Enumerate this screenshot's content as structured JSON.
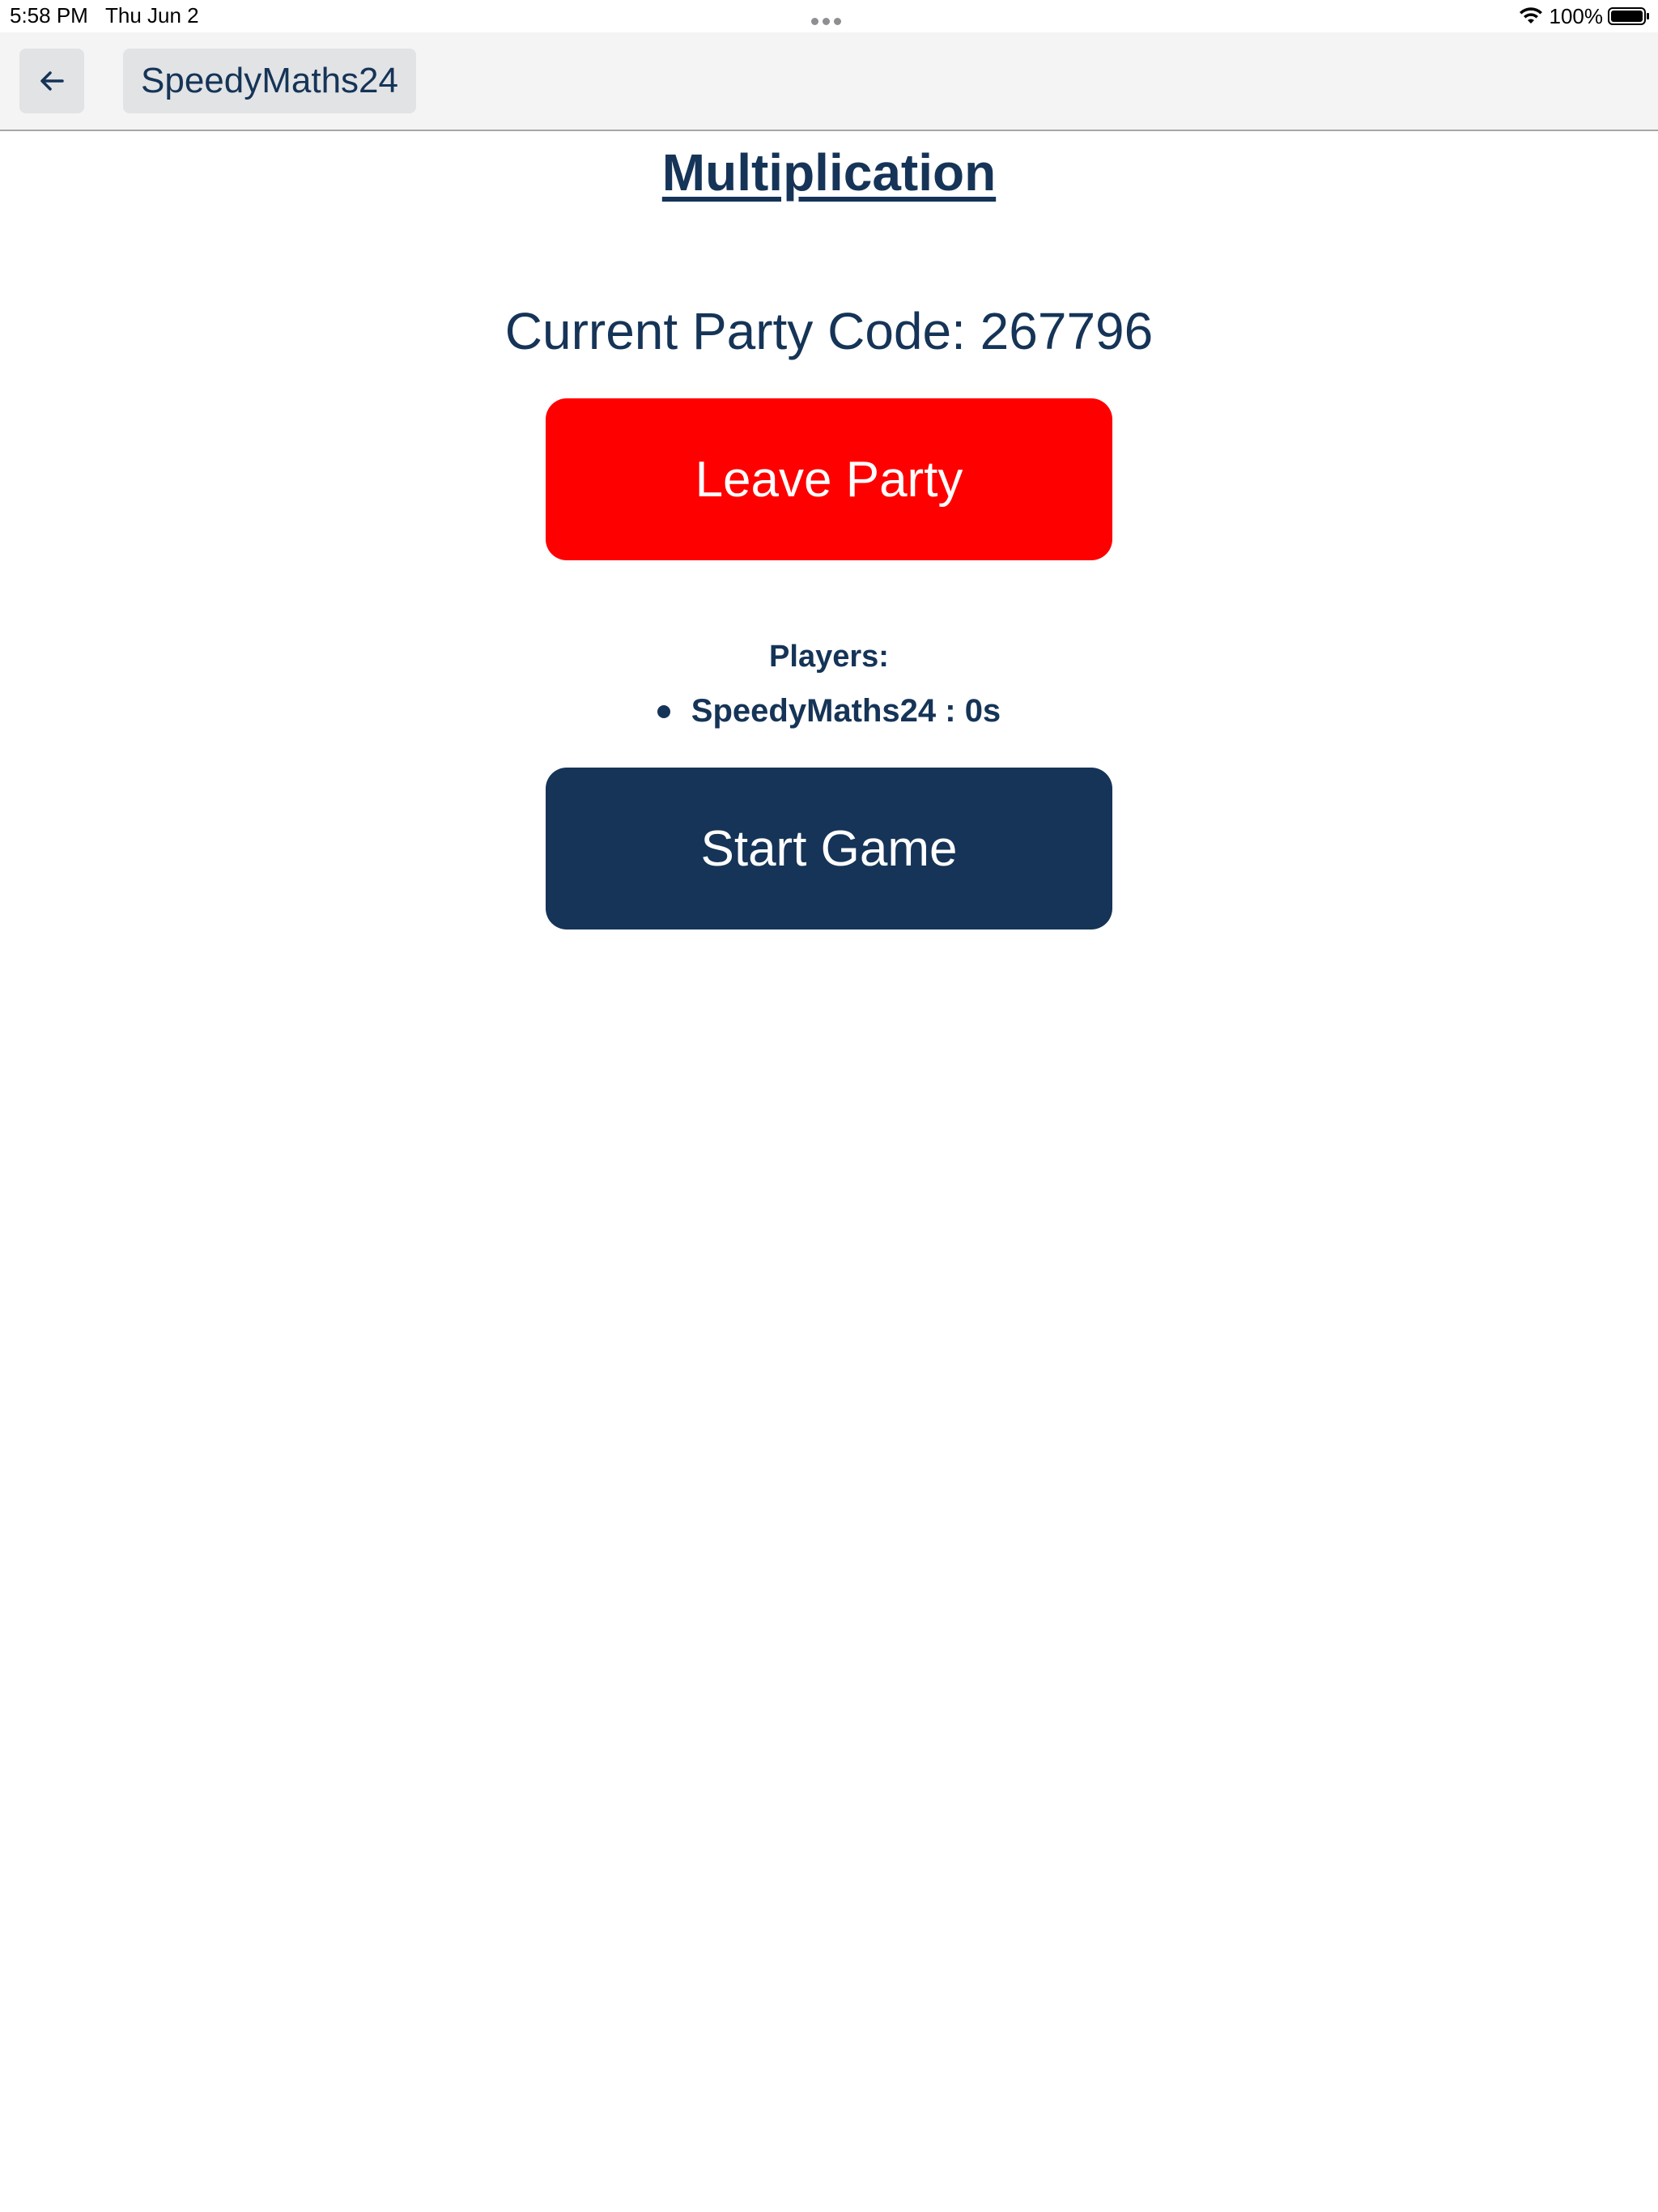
{
  "status_bar": {
    "time": "5:58 PM",
    "date": "Thu Jun 2",
    "battery": "100%"
  },
  "toolbar": {
    "back_icon": "arrow-left-icon",
    "username": "SpeedyMaths24"
  },
  "main": {
    "title": "Multiplication",
    "party_code_label": "Current Party Code: 267796",
    "leave_button": "Leave Party",
    "players_heading": "Players:",
    "players": [
      {
        "entry": "SpeedyMaths24 : 0s"
      }
    ],
    "start_button": "Start Game"
  },
  "colors": {
    "primary": "#153457",
    "danger": "#ff0000",
    "toolbar_bg": "#f4f4f4",
    "chip_bg": "#e2e3e5"
  }
}
